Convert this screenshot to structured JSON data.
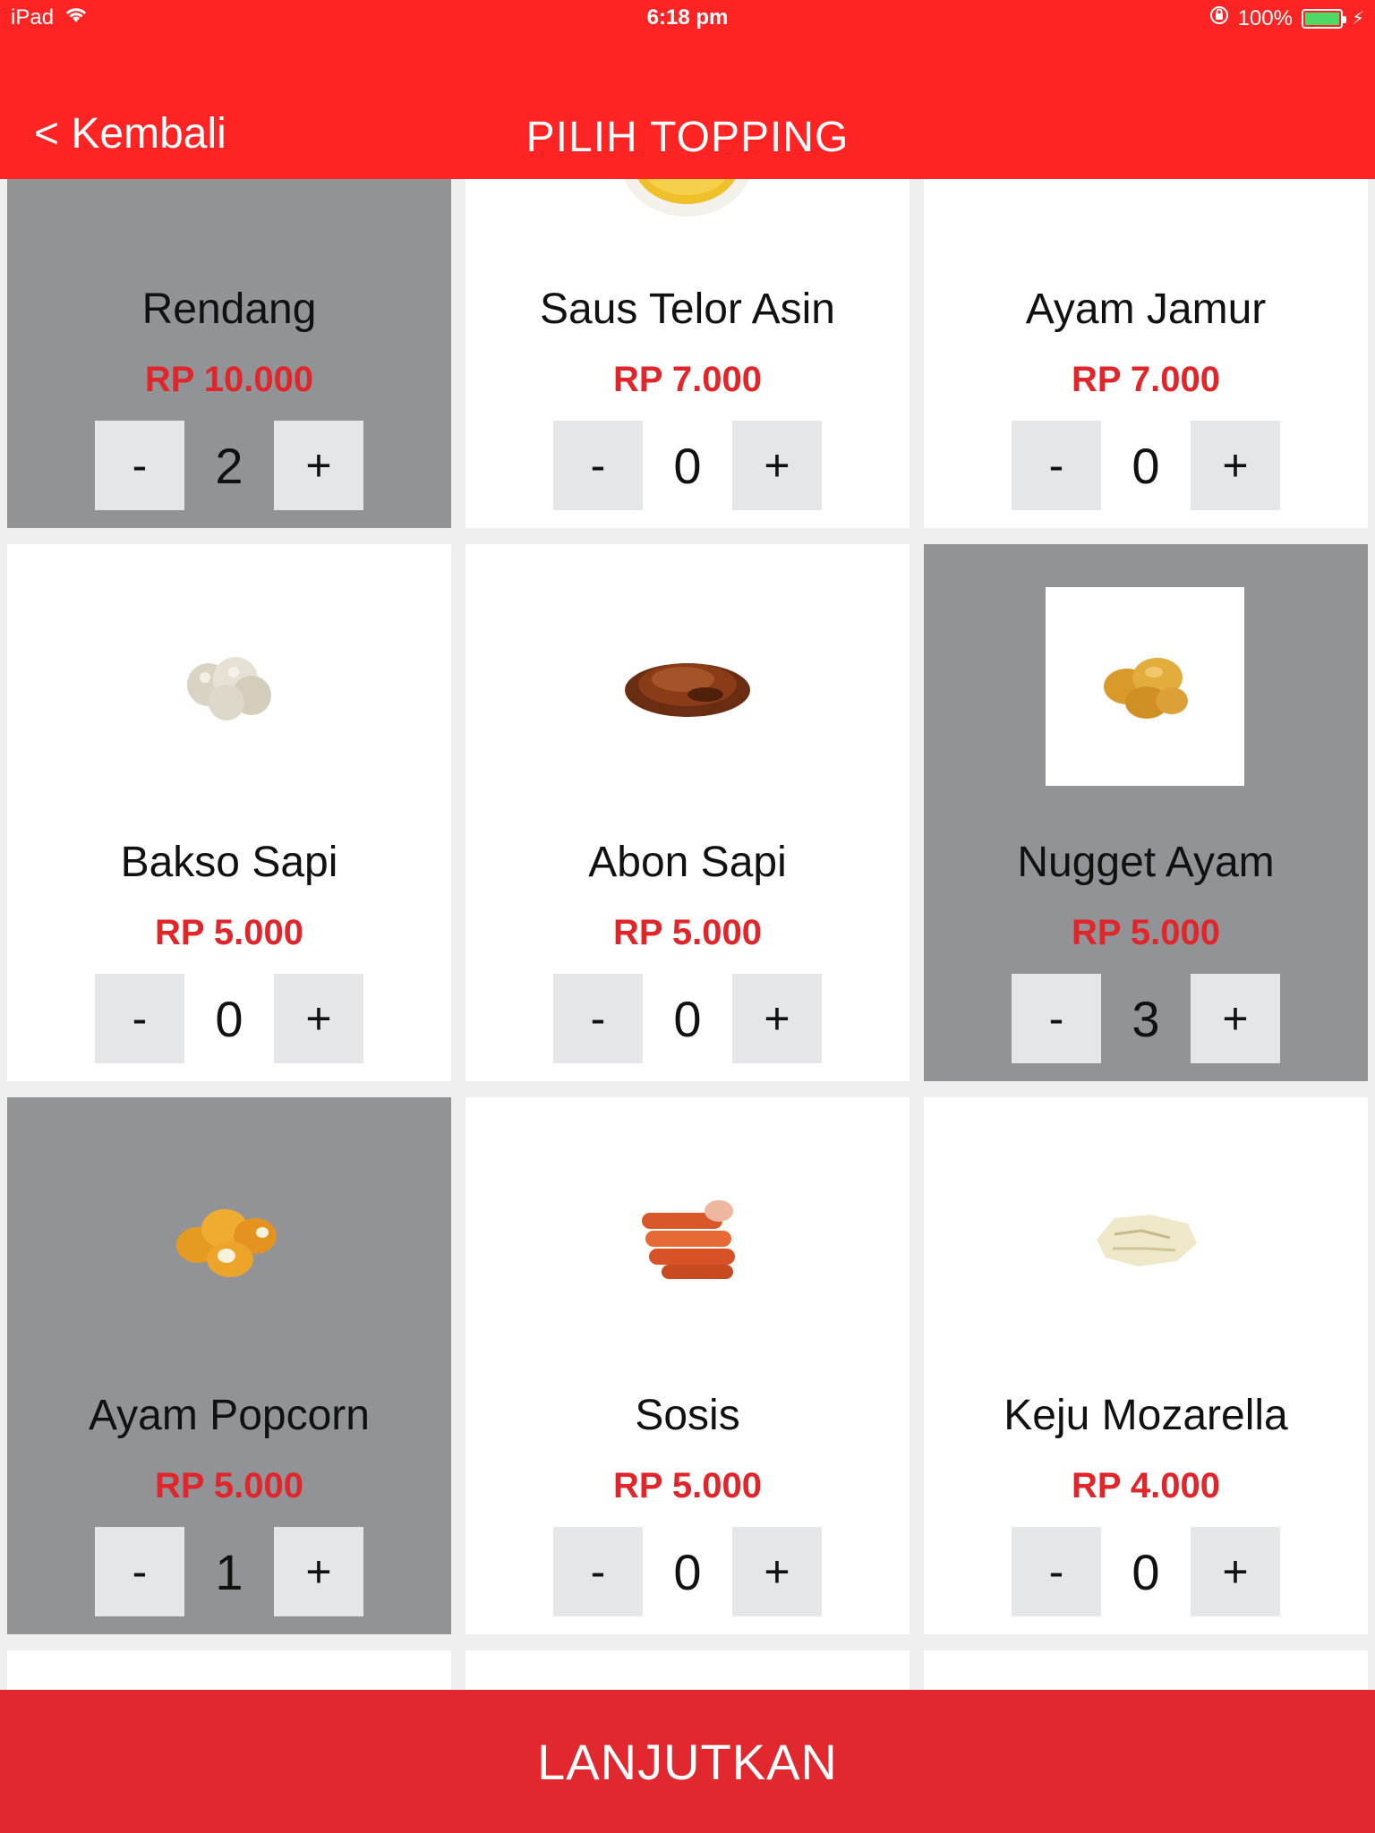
{
  "status_bar": {
    "device": "iPad",
    "time": "6:18 pm",
    "battery": "100%"
  },
  "header": {
    "back_label": "< Kembali",
    "title": "PILIH TOPPING"
  },
  "toppings": [
    {
      "name": "Rendang",
      "price": "RP 10.000",
      "qty": "2",
      "selected": true,
      "minus": "-",
      "plus": "+"
    },
    {
      "name": "Saus Telor Asin",
      "price": "RP 7.000",
      "qty": "0",
      "selected": false,
      "minus": "-",
      "plus": "+"
    },
    {
      "name": "Ayam Jamur",
      "price": "RP 7.000",
      "qty": "0",
      "selected": false,
      "minus": "-",
      "plus": "+"
    },
    {
      "name": "Bakso Sapi",
      "price": "RP 5.000",
      "qty": "0",
      "selected": false,
      "minus": "-",
      "plus": "+"
    },
    {
      "name": "Abon Sapi",
      "price": "RP 5.000",
      "qty": "0",
      "selected": false,
      "minus": "-",
      "plus": "+"
    },
    {
      "name": "Nugget Ayam",
      "price": "RP 5.000",
      "qty": "3",
      "selected": true,
      "minus": "-",
      "plus": "+"
    },
    {
      "name": "Ayam Popcorn",
      "price": "RP 5.000",
      "qty": "1",
      "selected": true,
      "minus": "-",
      "plus": "+"
    },
    {
      "name": "Sosis",
      "price": "RP 5.000",
      "qty": "0",
      "selected": false,
      "minus": "-",
      "plus": "+"
    },
    {
      "name": "Keju Mozarella",
      "price": "RP 4.000",
      "qty": "0",
      "selected": false,
      "minus": "-",
      "plus": "+"
    }
  ],
  "footer": {
    "continue_label": "LANJUTKAN"
  },
  "colors": {
    "header": "#fe2424",
    "footer": "#e1282e",
    "price": "#e0262a",
    "selected_card": "#929397",
    "stepper_button": "#e5e6e8"
  }
}
